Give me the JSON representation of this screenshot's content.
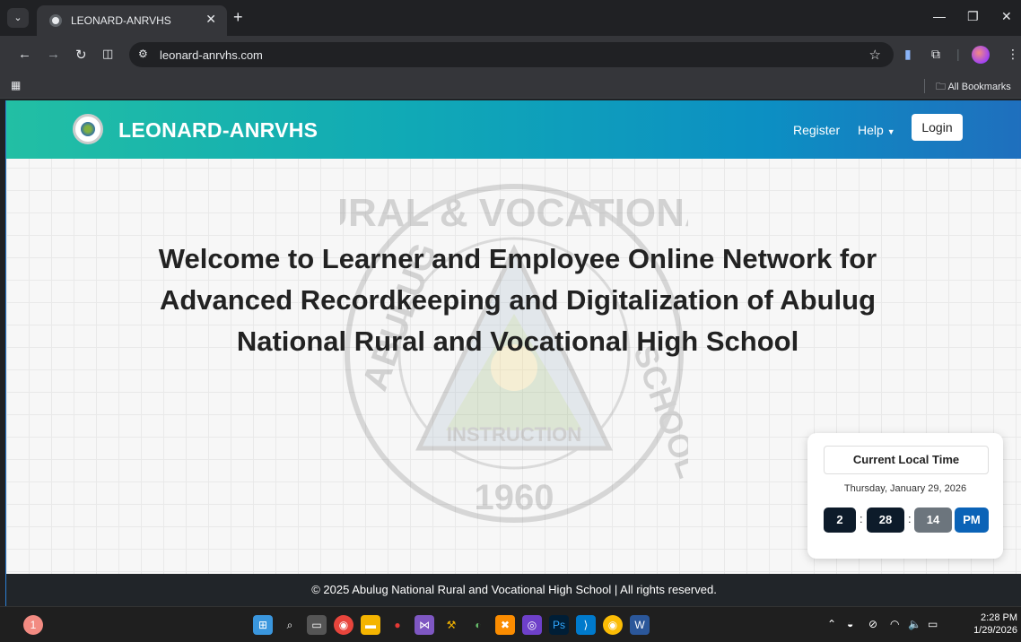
{
  "browser": {
    "tab_title": "LEONARD-ANRVHS",
    "url": "leonard-anrvhs.com",
    "bookmarks_label": "All Bookmarks"
  },
  "site": {
    "brand": "LEONARD-ANRVHS",
    "nav": {
      "register": "Register",
      "help": "Help",
      "login": "Login"
    },
    "hero_title": "Welcome to Learner and Employee Online Network for Advanced Recordkeeping and Digitalization of Abulug National Rural and Vocational High School",
    "watermark": {
      "top_text": "RURAL & VOCATIONAL",
      "left_text": "ABULUG",
      "right_text": "SCHOOL",
      "instruction": "INSTRUCTION",
      "year": "1960"
    },
    "clock": {
      "heading": "Current Local Time",
      "date": "Thursday, January 29, 2026",
      "hours": "2",
      "minutes": "28",
      "seconds": "14",
      "period": "PM"
    },
    "footer": "© 2025 Abulug National Rural and Vocational High School | All rights reserved."
  },
  "taskbar": {
    "time": "2:28 PM",
    "date": "1/29/2026",
    "notification_count": "1"
  },
  "colors": {
    "navbar_start": "#22bfa4",
    "navbar_end": "#1f6fbe",
    "clock_dark": "#0d1b2a",
    "clock_gray": "#6c757d",
    "clock_blue": "#0b63b7",
    "footer_bg": "#212529"
  }
}
